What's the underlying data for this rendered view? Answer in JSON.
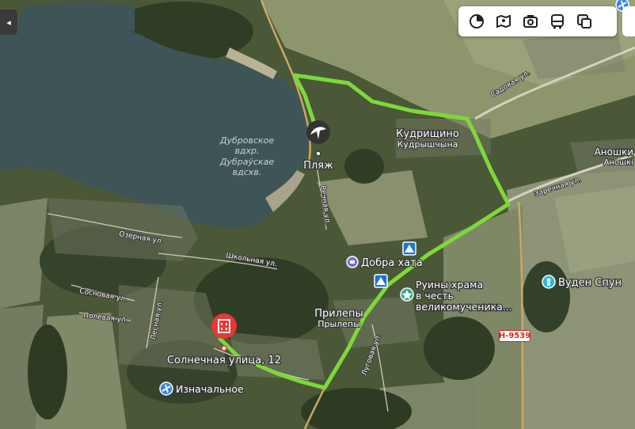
{
  "map": {
    "reservoir": {
      "name_ru": "Дубровское",
      "name_ru2": "вдхр.",
      "name_be": "Дубраўскае",
      "name_be2": "вдсхв."
    },
    "beach": {
      "label": "Пляж"
    },
    "village_1": {
      "name": "Кудрищино",
      "name_be": "Кудрышчына"
    },
    "village_2": {
      "name": "Прилепы",
      "name_be": "Прылепы"
    },
    "village_3": {
      "name": "Аношки",
      "name_be": "Аношкі"
    },
    "poi_hotel": {
      "label": "Добра хата"
    },
    "poi_church": {
      "label_line1": "Руины храма",
      "label_line2": "в честь",
      "label_line3": "великомученика..."
    },
    "poi_vuden": {
      "label": "Вуден Спун"
    },
    "poi_izn": {
      "label": "Изначальное"
    },
    "destination": {
      "label": "Солнечная улица, 12"
    },
    "road_badge": "Н-9539",
    "streets": {
      "ozernaya": "Озерная ул.",
      "shkolnaya": "Школьная ул.",
      "sosnovaya": "Сосновая ул.",
      "polevaya": "Полевая ул.",
      "lesnaya": "Лесная ул.",
      "zarechnaya": "Заречная ул.",
      "sadovaya": "Садовая ул.",
      "rechnaya": "Речная ул.",
      "lugovaya": "Луговая ул.",
      "lipovaya": "Липовая ул."
    },
    "route_color": "#7ed83a",
    "pin_color": "#e53935"
  },
  "toolbar": {
    "buttons": [
      {
        "icon": "layers-icon"
      },
      {
        "icon": "panorama-icon"
      },
      {
        "icon": "photo-icon"
      },
      {
        "icon": "transport-icon"
      },
      {
        "icon": "map-type-icon"
      }
    ]
  },
  "sidebar": {
    "collapse_glyph": "◂"
  }
}
